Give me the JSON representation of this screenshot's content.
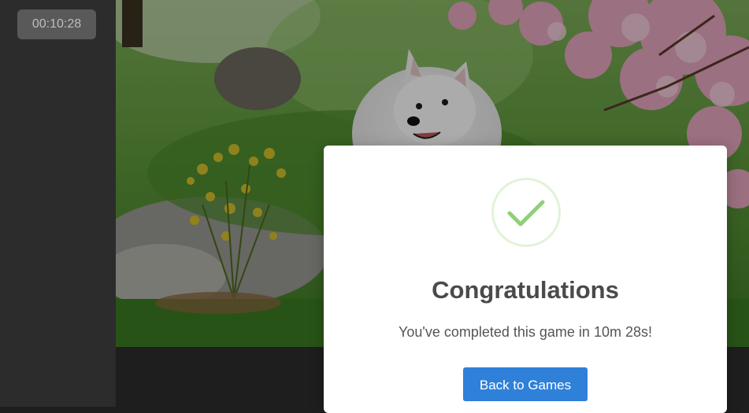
{
  "timer": {
    "value": "00:10:28"
  },
  "modal": {
    "title": "Congratulations",
    "message": "You've completed this game in 10m 28s!",
    "button_label": "Back to Games"
  },
  "colors": {
    "accent": "#2f80d9",
    "success": "#8fd07a",
    "sidebar": "#2c2c2c"
  }
}
